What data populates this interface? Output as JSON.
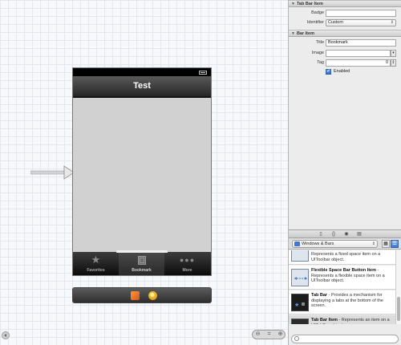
{
  "canvas": {
    "nav_title": "Test",
    "tabs": [
      {
        "label": "Favorites",
        "icon": "star-icon",
        "selected": false
      },
      {
        "label": "Bookmark",
        "icon": "bookmark-icon",
        "selected": true
      },
      {
        "label": "More",
        "icon": "more-icon",
        "selected": false
      }
    ]
  },
  "inspector": {
    "tab_bar_item": {
      "header": "Tab Bar Item",
      "badge_label": "Badge",
      "badge_value": "",
      "identifier_label": "Identifier",
      "identifier_value": "Custom"
    },
    "bar_item": {
      "header": "Bar Item",
      "title_label": "Title",
      "title_value": "Bookmark",
      "image_label": "Image",
      "image_value": "",
      "tag_label": "Tag",
      "tag_value": "0",
      "enabled_label": "Enabled",
      "enabled_checked": true
    }
  },
  "library": {
    "category": "Windows & Bars",
    "items": [
      {
        "title": "",
        "desc": "Represents a fixed space item on a UIToolbar object."
      },
      {
        "title": "Flexible Space Bar Button Item",
        "desc": " - Represents a flexible space item on a UIToolbar object."
      },
      {
        "title": "Tab Bar",
        "desc": " - Provides a mechanism for displaying a tabs at the bottom of the screen."
      },
      {
        "title": "Tab Bar Item",
        "desc": " - Represents an item on a UITabBar object."
      }
    ],
    "search_value": ""
  },
  "colors": {
    "selection_blue": "#3a76d6",
    "content_gray": "#d1d1d1"
  }
}
